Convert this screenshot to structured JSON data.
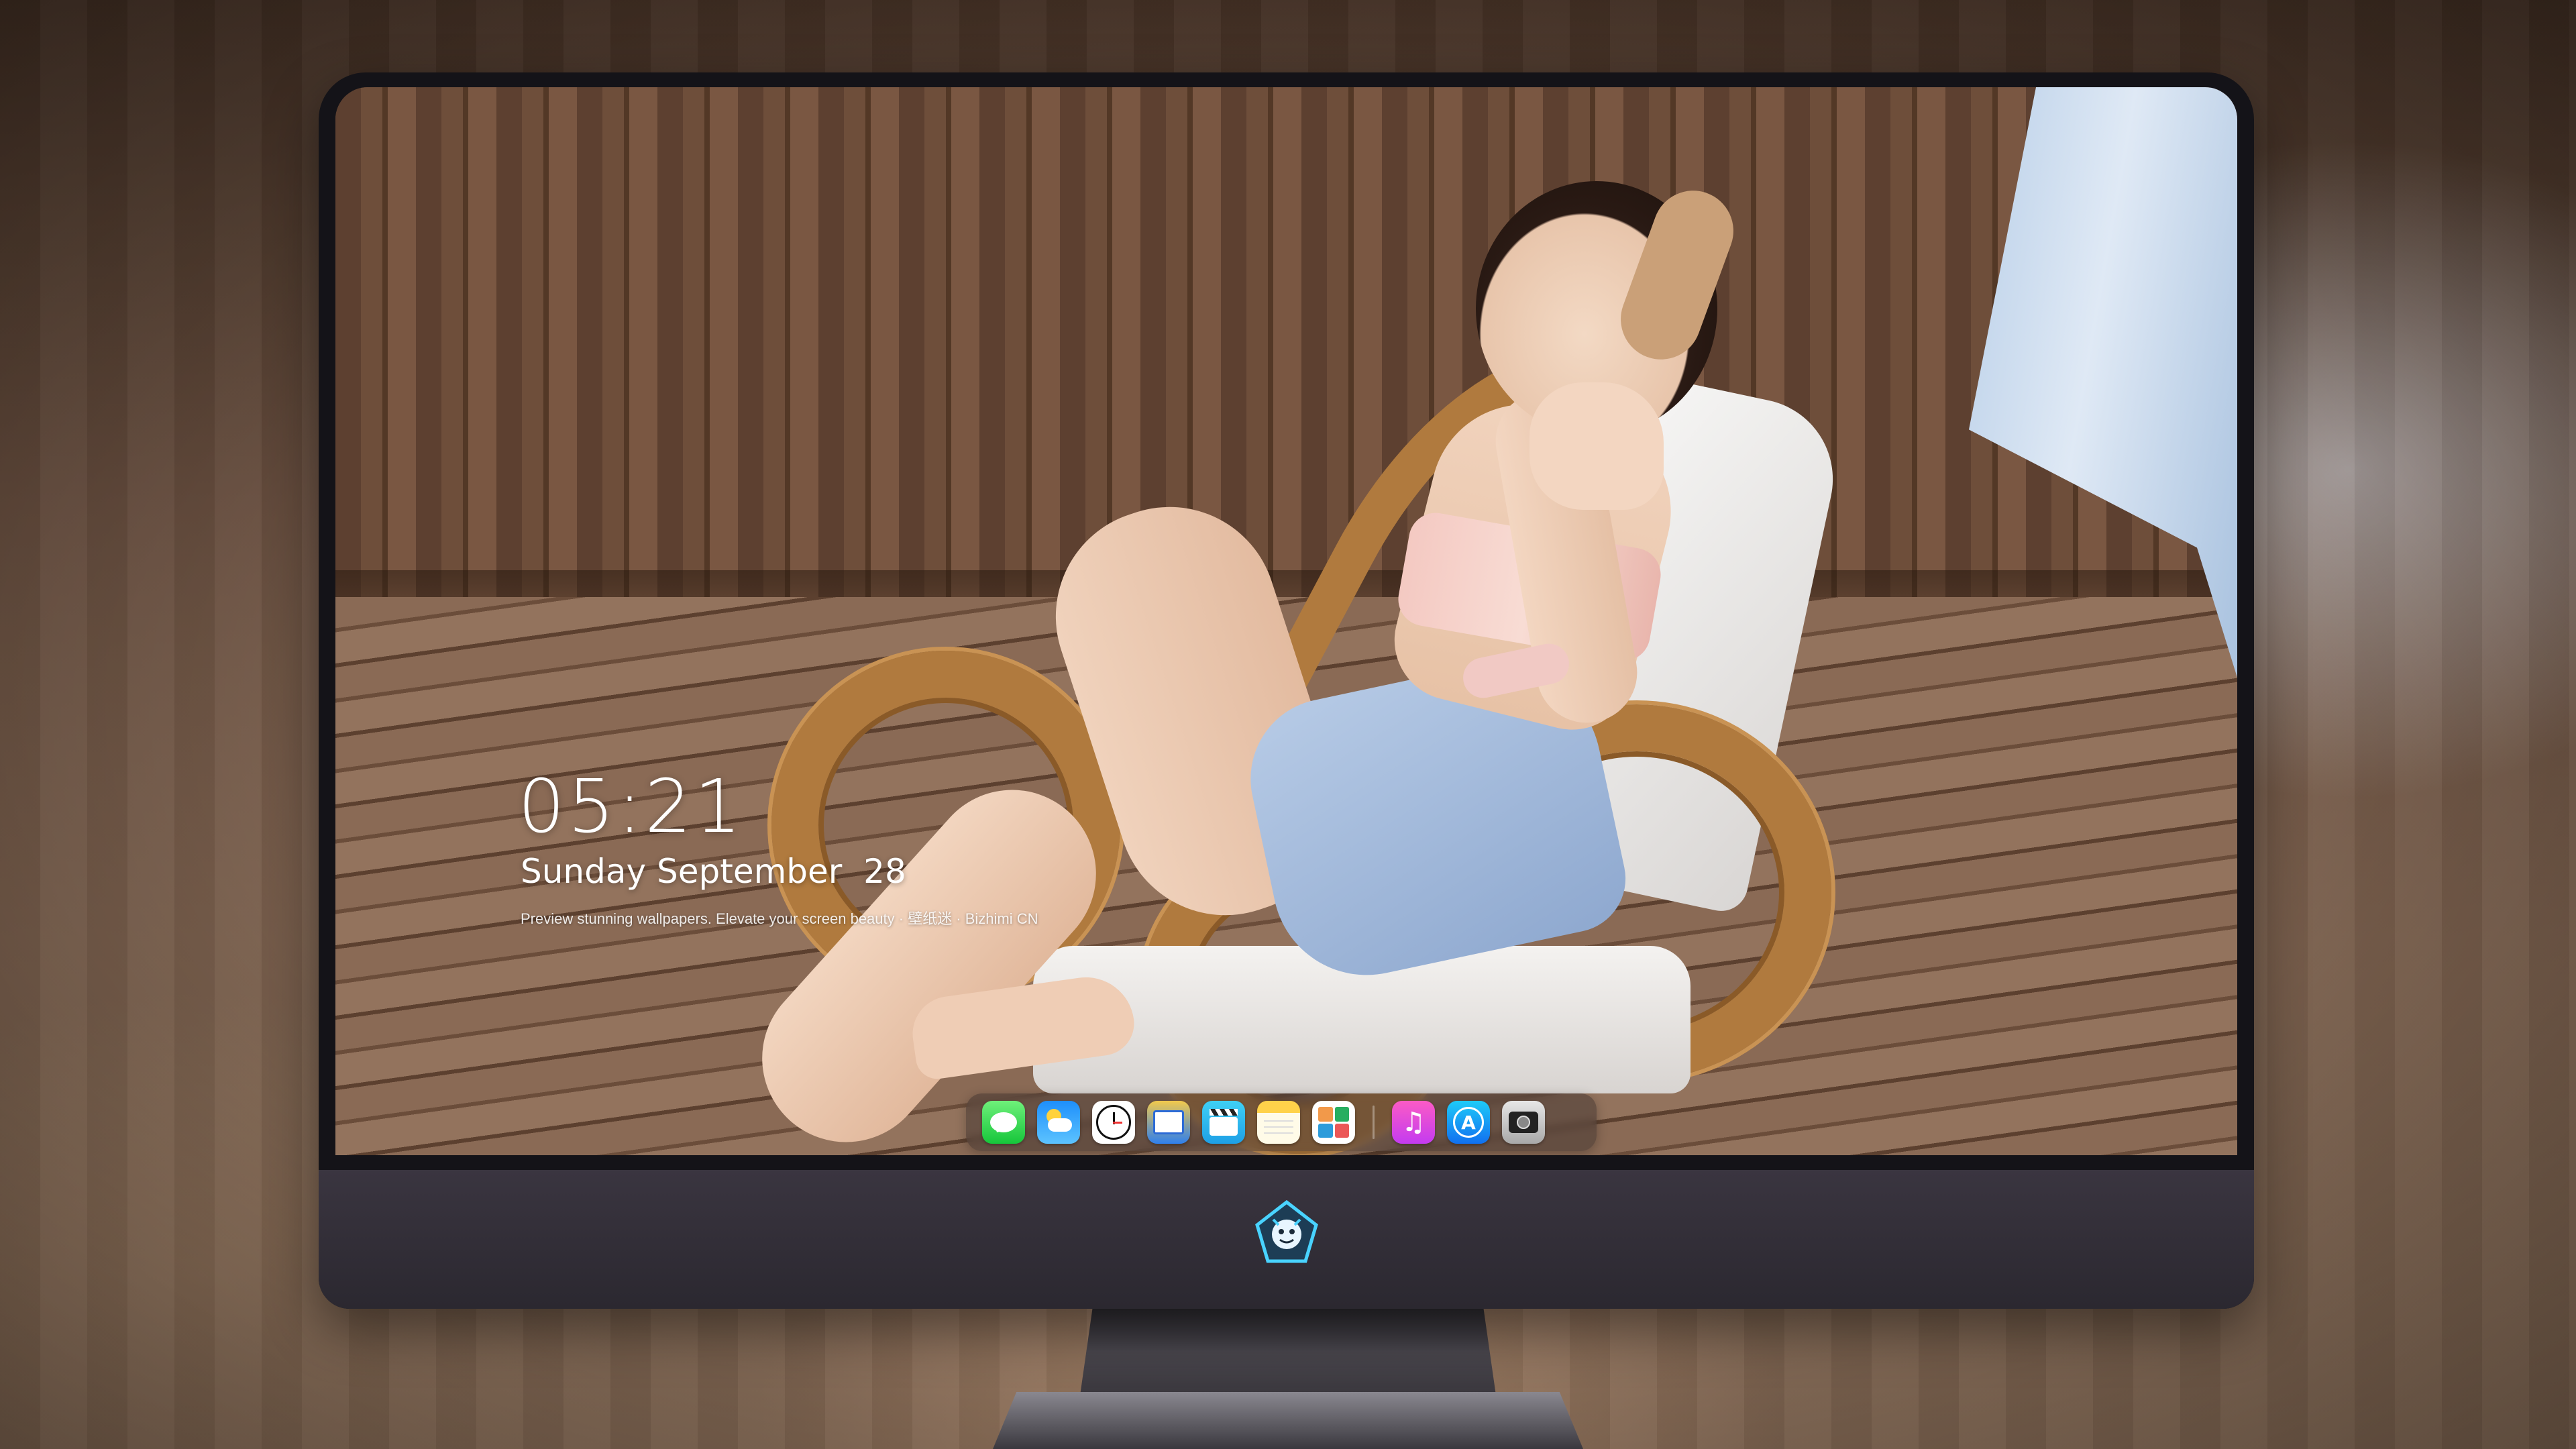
{
  "lockscreen": {
    "time": "05:21",
    "date": "Sunday September  28",
    "tagline": "Preview stunning wallpapers. Elevate your screen beauty · 壁纸迷 · Bizhimi CN"
  },
  "dock": {
    "apps": [
      {
        "icon": "messages-icon"
      },
      {
        "icon": "weather-icon"
      },
      {
        "icon": "clock-icon"
      },
      {
        "icon": "preview-icon"
      },
      {
        "icon": "clips-icon"
      },
      {
        "icon": "notes-icon"
      },
      {
        "icon": "photos-icon"
      },
      {
        "icon": "music-icon",
        "glyph": "♫"
      },
      {
        "icon": "app-store-icon",
        "glyph": "A"
      },
      {
        "icon": "camera-icon"
      }
    ]
  },
  "monitor": {
    "logo": "dragon-mascot-logo"
  }
}
